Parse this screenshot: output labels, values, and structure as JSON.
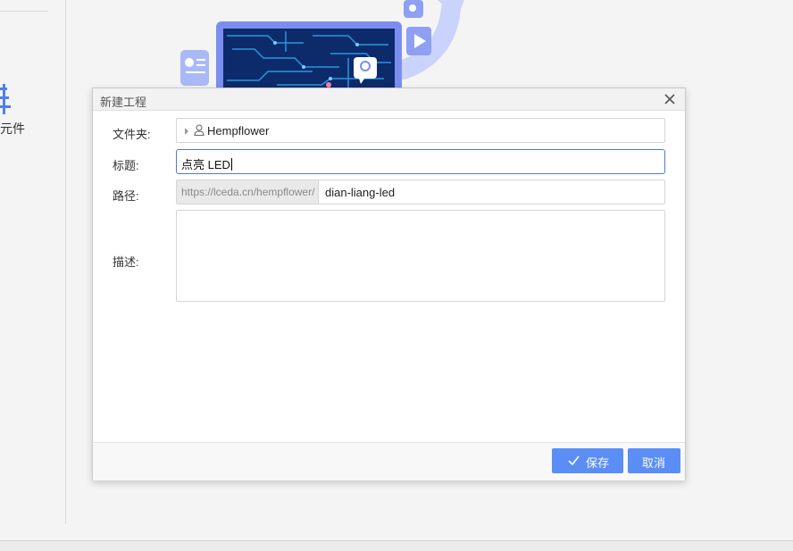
{
  "sidebar": {
    "component_label": "元件"
  },
  "dialog": {
    "title": "新建工程",
    "folder": {
      "label": "文件夹:",
      "value": "Hempflower"
    },
    "title_field": {
      "label": "标题:",
      "value": "点亮 LED"
    },
    "path": {
      "label": "路径:",
      "prefix": "https://lceda.cn/hempflower/",
      "value": "dian-liang-led"
    },
    "description": {
      "label": "描述:",
      "value": ""
    },
    "buttons": {
      "save": "保存",
      "cancel": "取消"
    }
  },
  "colors": {
    "primary": "#5a8ef5",
    "focus_border": "#4f78d8",
    "hero_blue": "#7b8ef0"
  }
}
